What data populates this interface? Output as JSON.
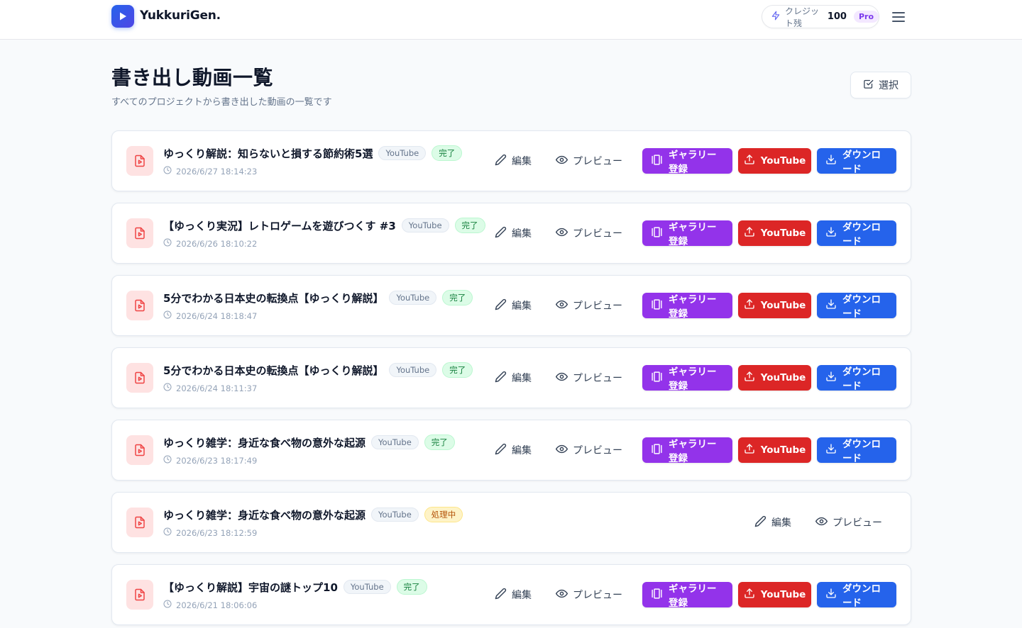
{
  "header": {
    "app_name": "YukkuriGen.",
    "credit_label": "クレジット残",
    "credit_value": "100",
    "plan_badge": "Pro"
  },
  "page": {
    "title": "書き出し動画一覧",
    "subtitle": "すべてのプロジェクトから書き出した動画の一覧です",
    "select_label": "選択"
  },
  "actions": {
    "edit": "編集",
    "preview": "プレビュー",
    "gallery": "ギャラリー登録",
    "youtube": "YouTube",
    "download": "ダウンロード"
  },
  "colors": {
    "gallery": "#9333ea",
    "youtube": "#dc2626",
    "download": "#2563eb",
    "done": "#15803d",
    "processing": "#b45309"
  },
  "videos": [
    {
      "title": "ゆっくり解説：知らないと損する節約術5選",
      "platform": "YouTube",
      "status": "完了",
      "date": "2026/6/27 18:14:23"
    },
    {
      "title": "【ゆっくり実況】レトロゲームを遊びつくす #3",
      "platform": "YouTube",
      "status": "完了",
      "date": "2026/6/26 18:10:22"
    },
    {
      "title": "5分でわかる日本史の転換点【ゆっくり解説】",
      "platform": "YouTube",
      "status": "完了",
      "date": "2026/6/24 18:18:47"
    },
    {
      "title": "5分でわかる日本史の転換点【ゆっくり解説】",
      "platform": "YouTube",
      "status": "完了",
      "date": "2026/6/24 18:11:37"
    },
    {
      "title": "ゆっくり雑学：身近な食べ物の意外な起源",
      "platform": "YouTube",
      "status": "完了",
      "date": "2026/6/23 18:17:49"
    },
    {
      "title": "ゆっくり雑学：身近な食べ物の意外な起源",
      "platform": "YouTube",
      "status": "処理中",
      "date": "2026/6/23 18:12:59"
    },
    {
      "title": "【ゆっくり解説】宇宙の謎トップ10",
      "platform": "YouTube",
      "status": "完了",
      "date": "2026/6/21 18:06:06"
    }
  ]
}
